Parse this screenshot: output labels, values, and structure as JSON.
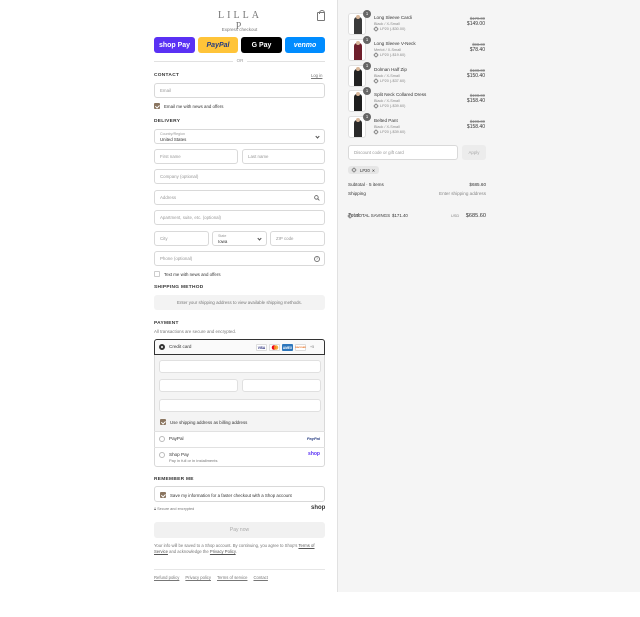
{
  "brand": {
    "logo_text": "LILLA P"
  },
  "express": {
    "label": "Express checkout",
    "buttons": [
      {
        "label": "shop Pay",
        "bg": "#5a31f4",
        "fg": "#ffffff"
      },
      {
        "label": "PayPal",
        "bg": "#ffc439",
        "fg": "#253b80"
      },
      {
        "label": "G Pay",
        "bg": "#000000",
        "fg": "#ffffff"
      },
      {
        "label": "venmo",
        "bg": "#008cff",
        "fg": "#ffffff"
      }
    ],
    "or_text": "OR"
  },
  "contact": {
    "title": "CONTACT",
    "login_link": "Log in",
    "email_placeholder": "Email",
    "email_news": "Email me with news and offers"
  },
  "delivery": {
    "title": "DELIVERY",
    "country_label": "Country/Region",
    "country_value": "United States",
    "first_name": "First name",
    "last_name": "Last name",
    "company": "Company (optional)",
    "address": "Address",
    "apartment": "Apartment, suite, etc. (optional)",
    "city": "City",
    "state_label": "State",
    "state_value": "Iowa",
    "zip": "ZIP code",
    "phone": "Phone (optional)",
    "text_news": "Text me with news and offers"
  },
  "shipping_method": {
    "title": "SHIPPING METHOD",
    "notice": "Enter your shipping address to view available shipping methods."
  },
  "payment": {
    "title": "PAYMENT",
    "subtitle": "All transactions are secure and encrypted.",
    "credit_card_label": "Credit card",
    "card_brands": [
      {
        "label": "VISA",
        "bg": "#ffffff",
        "fg": "#1a1f71"
      },
      {
        "label": "MC",
        "bg": "#ffffff",
        "fg": "#eb001b"
      },
      {
        "label": "AMEX",
        "bg": "#2e77bc",
        "fg": "#ffffff"
      },
      {
        "label": "DISCOVER",
        "bg": "#ffffff",
        "fg": "#e65c00"
      }
    ],
    "more_cards": "+5",
    "billing_same": "Use shipping address as billing address",
    "paypal_label": "PayPal",
    "paypal_badge": "PayPal",
    "shoppay_label": "Shop Pay",
    "shoppay_sub": "Pay in full or in installments",
    "shoppay_badge": "shop"
  },
  "remember": {
    "title": "REMEMBER ME",
    "save_label": "Save my information for a faster checkout with a Shop account",
    "secure_text": "Secure and encrypted",
    "shop_badge": "shop"
  },
  "pay_now": "Pay now",
  "legal": {
    "text_before": "Your info will be saved to a Shop account. By continuing, you agree to Shop's",
    "terms": "Terms of Service",
    "text_mid": "and acknowledge the",
    "privacy": "Privacy Policy",
    "text_end": "."
  },
  "footer_links": [
    "Refund policy",
    "Privacy policy",
    "Terms of service",
    "Contact"
  ],
  "items": [
    {
      "qty": "1",
      "name": "Long Sleeve Cardi",
      "variant": "Black / X-Small",
      "discount": "LP20 (-$30.00)",
      "old_price": "$179.00",
      "new_price": "$149.00",
      "color": "#3a3a3a"
    },
    {
      "qty": "1",
      "name": "Long Sleeve V-Neck",
      "variant": "Merlot / X-Small",
      "discount": "LP20 (-$19.60)",
      "old_price": "$98.00",
      "new_price": "$78.40",
      "color": "#6e1f2c"
    },
    {
      "qty": "1",
      "name": "Dolman Half Zip",
      "variant": "Black / X-Small",
      "discount": "LP20 (-$37.60)",
      "old_price": "$188.00",
      "new_price": "$150.40",
      "color": "#222222"
    },
    {
      "qty": "1",
      "name": "Split Neck Collared Dress",
      "variant": "Black / X-Small",
      "discount": "LP20 (-$39.60)",
      "old_price": "$198.00",
      "new_price": "$158.40",
      "color": "#1e1e1e"
    },
    {
      "qty": "1",
      "name": "Belted Pant",
      "variant": "Black / X-Small",
      "discount": "LP20 (-$39.60)",
      "old_price": "$198.00",
      "new_price": "$158.40",
      "color": "#2a2a2a"
    }
  ],
  "discount": {
    "placeholder": "Discount code or gift card",
    "apply": "Apply",
    "applied_code": "LP20",
    "remove": "✕"
  },
  "summary": {
    "subtotal_label": "Subtotal · 5 items",
    "subtotal_value": "$685.60",
    "shipping_label": "Shipping",
    "shipping_value": "Enter shipping address",
    "total_label": "Total",
    "currency": "USD",
    "total_value": "$685.60",
    "savings_label": "TOTAL SAVINGS",
    "savings_value": "$171.40"
  }
}
